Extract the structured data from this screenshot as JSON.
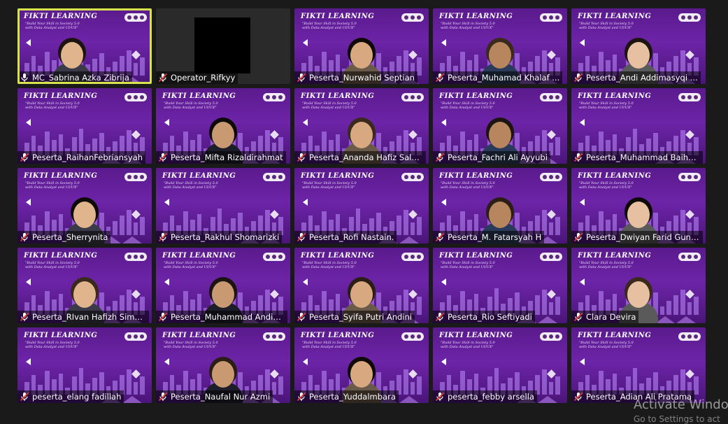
{
  "slide": {
    "title": "FIKTI LEARNING",
    "subtitle": "\"Build Your Skill in Society 5.0 with Data Analyst and UI/UX\""
  },
  "participants": [
    {
      "name": "MC_Sabrina Azka Zibrija",
      "muted": false,
      "active": true,
      "video": true
    },
    {
      "name": "Operator_Rifkyy",
      "muted": true,
      "active": false,
      "video": false
    },
    {
      "name": "Peserta_Nurwahid Septian",
      "muted": true,
      "active": false,
      "video": true
    },
    {
      "name": "Peserta_Muhamad Khalaf ...",
      "muted": true,
      "active": false,
      "video": true
    },
    {
      "name": "Peserta_Andi Addimasyqi ...",
      "muted": true,
      "active": false,
      "video": true
    },
    {
      "name": "Peserta_RaihanFebriansyah",
      "muted": true,
      "active": false,
      "video": false
    },
    {
      "name": "Peserta_Mifta Rizaldirahmat",
      "muted": true,
      "active": false,
      "video": true
    },
    {
      "name": "Peserta_Ananda Hafiz Sals...",
      "muted": true,
      "active": false,
      "video": true
    },
    {
      "name": "Peserta_Fachri Ali Ayyubi",
      "muted": true,
      "active": false,
      "video": true
    },
    {
      "name": "Peserta_Muhammad Baihaqi",
      "muted": true,
      "active": false,
      "video": false
    },
    {
      "name": "Peserta_Sherrynita",
      "muted": true,
      "active": false,
      "video": true
    },
    {
      "name": "Peserta_Rakhul Shomarizki",
      "muted": true,
      "active": false,
      "video": false
    },
    {
      "name": "Peserta_Rofi Nastain.",
      "muted": true,
      "active": false,
      "video": false
    },
    {
      "name": "Peserta_M. Fatarsyah H",
      "muted": true,
      "active": false,
      "video": true
    },
    {
      "name": "Peserta_Dwiyan Farid Guna...",
      "muted": true,
      "active": false,
      "video": true
    },
    {
      "name": "Peserta_RIvan Hafizh Simb...",
      "muted": true,
      "active": false,
      "video": true
    },
    {
      "name": "Peserta_Muhammad Andik...",
      "muted": true,
      "active": false,
      "video": true
    },
    {
      "name": "Peserta_Syifa Putri Andini",
      "muted": true,
      "active": false,
      "video": true
    },
    {
      "name": "Peserta_Rio Seftiyadi",
      "muted": true,
      "active": false,
      "video": false
    },
    {
      "name": "Clara Devira",
      "muted": true,
      "active": false,
      "video": true
    },
    {
      "name": "peserta_elang fadillah",
      "muted": true,
      "active": false,
      "video": false
    },
    {
      "name": "Peserta_Naufal Nur Azmi",
      "muted": true,
      "active": false,
      "video": true
    },
    {
      "name": "Peserta_Yuddalmbara",
      "muted": true,
      "active": false,
      "video": true
    },
    {
      "name": "peserta_febby arsella",
      "muted": true,
      "active": false,
      "video": false
    },
    {
      "name": "Peserta_Adian Ali Pratama",
      "muted": true,
      "active": false,
      "video": false
    }
  ],
  "os_watermark": {
    "line1": "Activate Windo",
    "line2": "Go to Settings to act"
  },
  "colors": {
    "active_border": "#d7e34a",
    "muted_icon": "#e53935",
    "slide_bg": "#6d24a8"
  }
}
